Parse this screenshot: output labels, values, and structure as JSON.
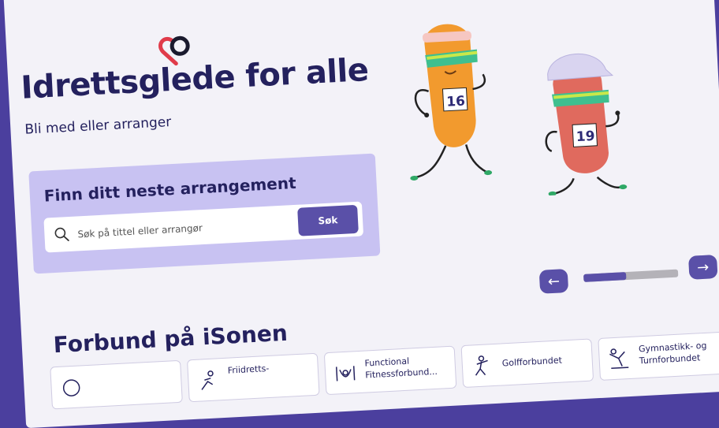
{
  "hero": {
    "title": "Idrettsglede for alle",
    "subtitle": "Bli med eller arranger"
  },
  "search": {
    "title": "Finn ditt neste arrangement",
    "placeholder": "Søk på tittel eller arrangør",
    "button_label": "Søk"
  },
  "illustration": {
    "runner_1_number": "16",
    "runner_2_number": "19"
  },
  "carousel": {
    "prev_icon": "arrow-left-icon",
    "next_icon": "arrow-right-icon",
    "progress_fraction": 0.45
  },
  "federations": {
    "title": "Forbund på iSonen",
    "items": [
      {
        "label": "",
        "icon": "sport-icon"
      },
      {
        "label": "Friidretts-",
        "icon": "athletics-icon"
      },
      {
        "label": "Functional\nFitnessforbund...",
        "icon": "fitness-icon"
      },
      {
        "label": "Golfforbundet",
        "icon": "golf-icon"
      },
      {
        "label": "Gymnastikk- og\nTurnforbundet",
        "icon": "gymnastics-icon"
      }
    ]
  },
  "colors": {
    "accent": "#5a50a8",
    "card": "#c8c2f2",
    "heading": "#24215e",
    "logo": "#e03b4a"
  }
}
